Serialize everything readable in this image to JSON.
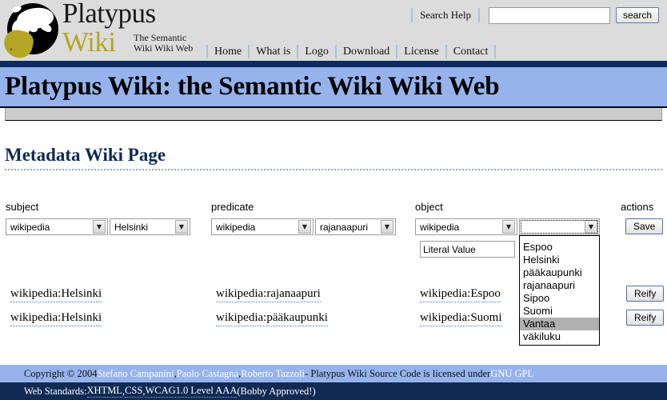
{
  "header": {
    "logo_alt": "platypus-logo",
    "wordmark_line1": "Platypus",
    "wordmark_line2": "Wiki",
    "tagline_line1": "The Semantic",
    "tagline_line2": "Wiki Wiki Web",
    "search_help_label": "Search Help",
    "search_value": "",
    "search_placeholder": "",
    "search_button_label": "search",
    "nav": [
      {
        "label": "Home"
      },
      {
        "label": "What is"
      },
      {
        "label": "Logo"
      },
      {
        "label": "Download"
      },
      {
        "label": "License"
      },
      {
        "label": "Contact"
      }
    ]
  },
  "banner": {
    "title": "Platypus Wiki: the Semantic Wiki Wiki Web"
  },
  "main": {
    "page_title": "Metadata Wiki Page",
    "columns": {
      "subject": "subject",
      "predicate": "predicate",
      "object": "object",
      "actions": "actions"
    },
    "form": {
      "subject_namespace": "wikipedia",
      "subject_value": "Helsinki",
      "predicate_namespace": "wikipedia",
      "predicate_value": "rajanaapuri",
      "object_namespace": "wikipedia",
      "object_value": "",
      "literal_value": "Literal Value",
      "save_label": "Save"
    },
    "object_dropdown": {
      "open": true,
      "selected": "Vantaa",
      "options": [
        "Espoo",
        "Helsinki",
        "pääkaupunki",
        "rajanaapuri",
        "Sipoo",
        "Suomi",
        "Vantaa",
        "väkiluku"
      ]
    },
    "triples": [
      {
        "subject": "wikipedia:Helsinki",
        "predicate": "wikipedia:rajanaapuri",
        "object": "wikipedia:Espoo",
        "action_label": "Reify"
      },
      {
        "subject": "wikipedia:Helsinki",
        "predicate": "wikipedia:pääkaupunki",
        "object": "wikipedia:Suomi",
        "action_label": "Reify"
      }
    ]
  },
  "footer": {
    "copyright_prefix": "Copyright © 2004 ",
    "author1": "Stefano Campanini",
    "author_sep1": ", ",
    "author2": "Paolo Castagna",
    "author_sep2": ", ",
    "author3": "Roberto Tazzoli",
    "license_text": " - Platypus Wiki Source Code is licensed under ",
    "license_link": "GNU GPL",
    "standards_prefix": "Web Standards: ",
    "standard1": "XHTML",
    "standards_sep1": ", ",
    "standard2": "CSS",
    "standards_sep2": ", ",
    "standard3": "WCAG1.0 Level AAA",
    "standards_suffix": " (Bobby Approved!)"
  },
  "colors": {
    "header_bg": "#dcdcdc",
    "navy": "#102a54",
    "banner_blue": "#96b3ec",
    "accent_yellow": "#b5a524",
    "divider_blue": "#a8c0e8"
  }
}
